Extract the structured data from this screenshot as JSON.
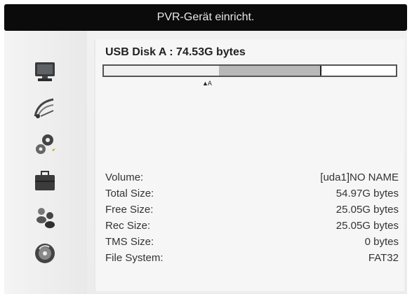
{
  "header": {
    "title": "PVR-Gerät einricht."
  },
  "sidebar": {
    "icons": [
      "tv-icon",
      "satellite-dish-icon",
      "gears-icon",
      "toolbox-icon",
      "people-icon",
      "disc-drive-icon"
    ]
  },
  "disk": {
    "title": "USB Disk A : 74.53G bytes",
    "usage_segments": {
      "free_pct": 39.5,
      "used_pct": 34.5,
      "white_pct": 26
    },
    "marker": "▲A"
  },
  "info": {
    "rows": [
      {
        "label": "Volume:",
        "value": "[uda1]NO NAME"
      },
      {
        "label": "Total Size:",
        "value": "54.97G bytes"
      },
      {
        "label": "Free Size:",
        "value": "25.05G bytes"
      },
      {
        "label": "Rec Size:",
        "value": "25.05G bytes"
      },
      {
        "label": "TMS Size:",
        "value": "0 bytes"
      },
      {
        "label": "File System:",
        "value": "FAT32"
      }
    ]
  },
  "colors": {
    "title_bg": "#0b0b0b",
    "title_text": "#e6e6e6",
    "panel_bg": "#f1f1f1",
    "bar_used": "#b8b8b8"
  }
}
